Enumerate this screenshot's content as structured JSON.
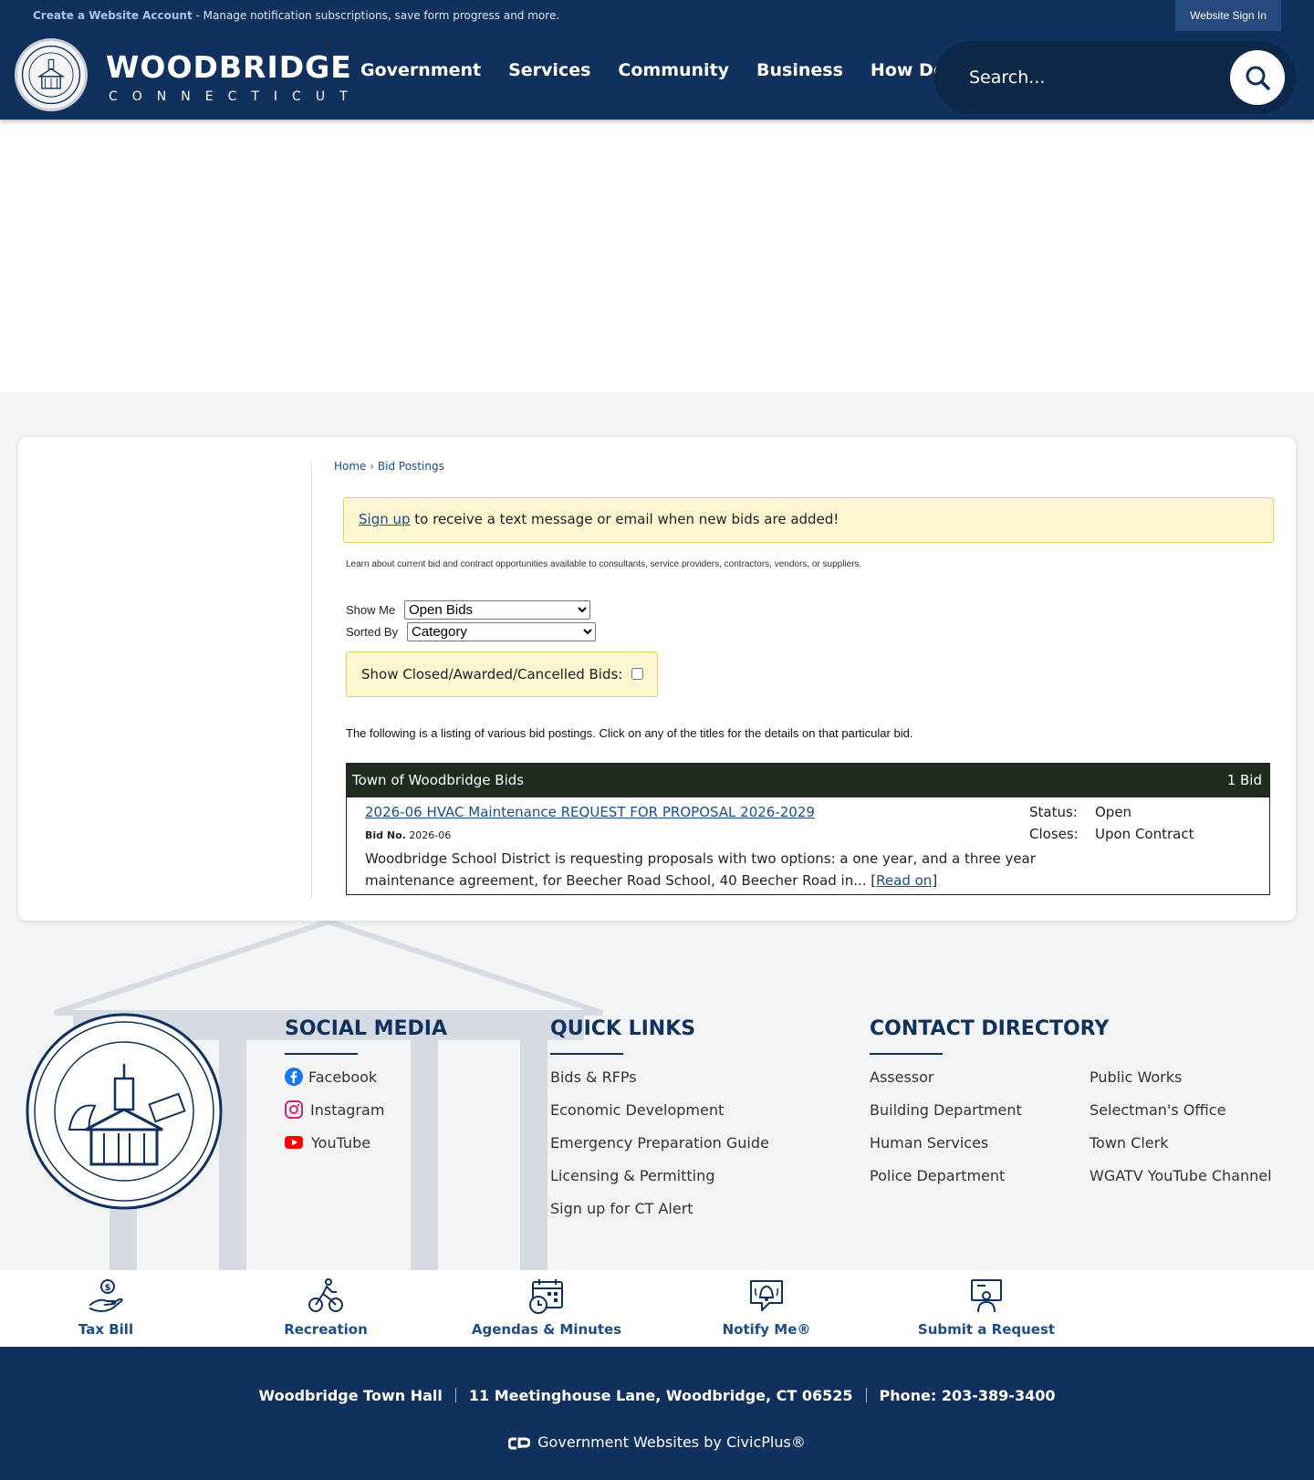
{
  "topbar": {
    "create_link": "Create a Website Account",
    "create_text": " - Manage notification subscriptions, save form progress and more.",
    "signin": "Website Sign In"
  },
  "header": {
    "logo_name": "WOODBRIDGE",
    "logo_sub": "CONNECTICUT",
    "nav": [
      "Government",
      "Services",
      "Community",
      "Business",
      "How Do I..."
    ],
    "search_placeholder": "Search..."
  },
  "breadcrumb": {
    "home": "Home",
    "sep": "›",
    "current": "Bid Postings"
  },
  "alert": {
    "link": "Sign up",
    "text": " to receive a text message or email when new bids are added!"
  },
  "intro": "Learn about current bid and contract opportunities available to consultants, service providers, contractors, vendors, or suppliers.",
  "filters": {
    "show_me_label": "Show Me",
    "show_me_value": "Open Bids",
    "sorted_by_label": "Sorted By",
    "sorted_by_value": "Category",
    "closed_label": "Show Closed/Awarded/Cancelled Bids:"
  },
  "listing_note": "The following is a listing of various bid postings. Click on any of the titles for the details on that particular bid.",
  "bids": {
    "category": "Town of Woodbridge Bids",
    "count": "1 Bid",
    "items": [
      {
        "title": "2026-06 HVAC Maintenance REQUEST FOR PROPOSAL 2026-2029",
        "bid_no_label": "Bid No.",
        "bid_no": "2026-06",
        "description": "Woodbridge School District is requesting proposals with two options: a one year, and a three year maintenance agreement, for Beecher Road School, 40 Beecher Road in... ",
        "read_on_open": "[",
        "read_on": "Read on",
        "read_on_close": "]",
        "status_label": "Status:",
        "status": "Open",
        "closes_label": "Closes:",
        "closes": "Upon Contract"
      }
    ]
  },
  "footer": {
    "social": {
      "heading": "SOCIAL MEDIA",
      "links": [
        "Facebook",
        "Instagram",
        "YouTube"
      ]
    },
    "quick_links": {
      "heading": "QUICK LINKS",
      "links": [
        "Bids & RFPs",
        "Economic Development",
        "Emergency Preparation Guide",
        "Licensing & Permitting",
        "Sign up for CT Alert"
      ]
    },
    "contact": {
      "heading": "CONTACT DIRECTORY",
      "col1": [
        "Assessor",
        "Building Department",
        "Human Services",
        "Police Department"
      ],
      "col2": [
        "Public Works",
        "Selectman's Office",
        "Town Clerk",
        "WGATV YouTube Channel"
      ]
    }
  },
  "quick_icons": [
    {
      "label": "Tax Bill",
      "icon": "hand-dollar-icon"
    },
    {
      "label": "Recreation",
      "icon": "cyclist-icon"
    },
    {
      "label": "Agendas & Minutes",
      "icon": "calendar-clock-icon"
    },
    {
      "label": "Notify Me®",
      "icon": "bell-icon"
    },
    {
      "label": "Submit a Request",
      "icon": "presenter-icon"
    }
  ],
  "bottom": {
    "hall": "Woodbridge Town Hall",
    "address": "11 Meetinghouse Lane, Woodbridge, CT 06525",
    "phone": "Phone: 203-389-3400",
    "civic": "Government Websites by CivicPlus®"
  },
  "colors": {
    "navy": "#10315e",
    "link_blue": "#1a4f8a",
    "alert_bg": "#fcf6d1",
    "table_head": "#1f2b1f"
  }
}
